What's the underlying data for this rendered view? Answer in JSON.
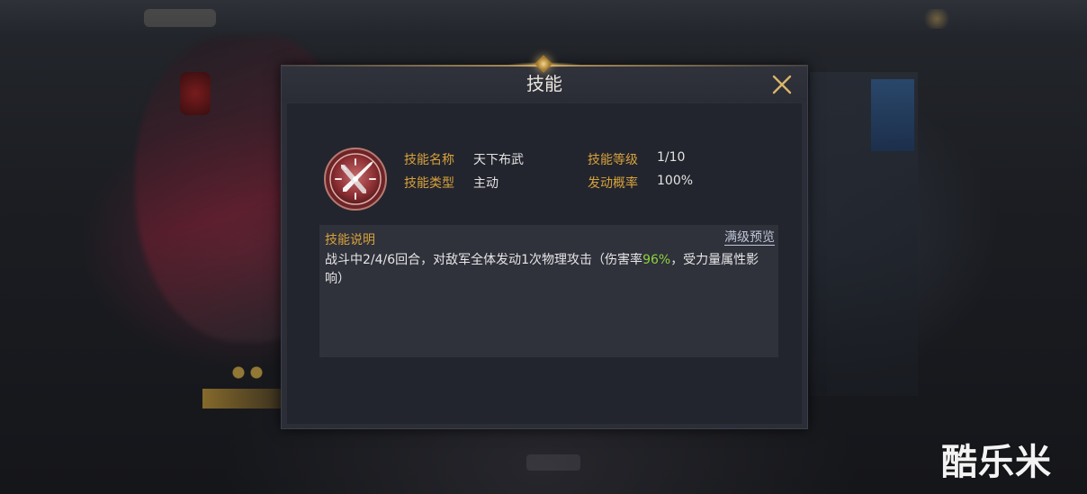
{
  "dialog": {
    "title": "技能",
    "close_icon": "close-icon"
  },
  "skill": {
    "icon": "crossed-swords-icon",
    "name_label": "技能名称",
    "name_value": "天下布武",
    "type_label": "技能类型",
    "type_value": "主动",
    "level_label": "技能等级",
    "level_value": "1/10",
    "chance_label": "发动概率",
    "chance_value": "100%"
  },
  "description": {
    "title": "技能说明",
    "max_level_link": "满级预览",
    "text_before": "战斗中2/4/6回合，对敌军全体发动1次物理攻击（伤害率",
    "highlight": "96%",
    "text_after": "，受力量属性影响）"
  },
  "watermark": "酷乐米",
  "colors": {
    "label_gold": "#d7a23b",
    "highlight_green": "#8dd33c",
    "panel_bg": "#2b2d37"
  }
}
